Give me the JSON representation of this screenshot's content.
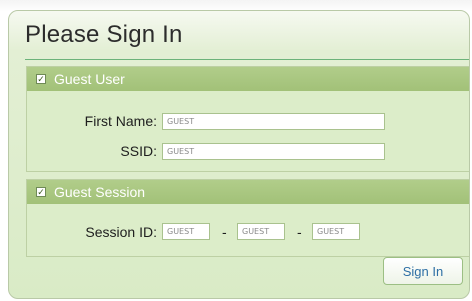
{
  "panel": {
    "title": "Please Sign In"
  },
  "guest_user": {
    "header": "Guest User",
    "checked": true,
    "first_name_label": "First Name:",
    "first_name_value": "GUEST",
    "ssid_label": "SSID:",
    "ssid_value": "GUEST"
  },
  "guest_session": {
    "header": "Guest Session",
    "checked": true,
    "session_id_label": "Session ID:",
    "session_id_parts": [
      "GUEST",
      "GUEST",
      "GUEST"
    ],
    "separator": "-"
  },
  "actions": {
    "sign_in_label": "Sign In"
  },
  "colors": {
    "panel_background": "#d9ebc6",
    "section_header": "#a8c680",
    "title_rule": "#6db37a",
    "button_text": "#2e6fa5"
  }
}
